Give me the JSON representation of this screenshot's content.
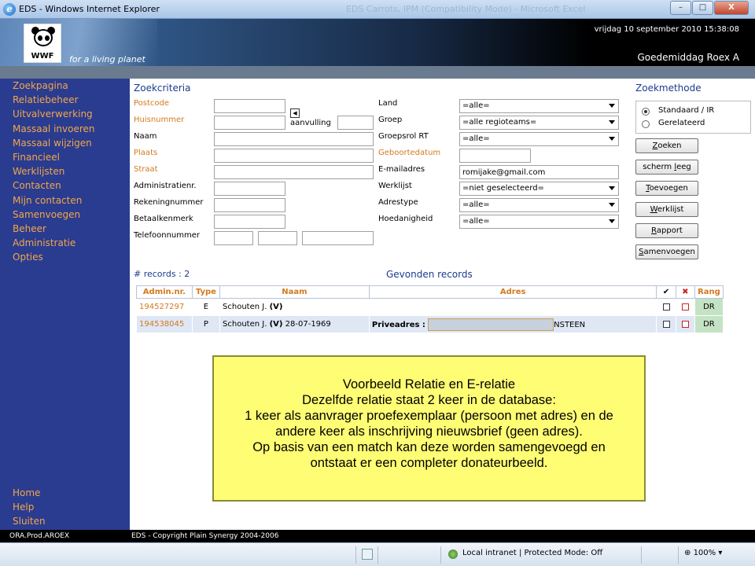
{
  "window": {
    "title": "EDS - Windows Internet Explorer",
    "faded_title": "EDS Carrots, IPM (Compatibility Mode) - Microsoft Excel",
    "controls": [
      "–",
      "□",
      "X"
    ]
  },
  "header": {
    "logo_text": "WWF",
    "tagline": "for a living planet",
    "datetime": "vrijdag 10 september 2010 15:38:08",
    "greeting": "Goedemiddag Roex A"
  },
  "sidebar": {
    "items": [
      {
        "label": "Zoekpagina"
      },
      {
        "label": "Relatiebeheer"
      },
      {
        "label": "Uitvalverwerking"
      },
      {
        "label": "Massaal invoeren"
      },
      {
        "label": "Massaal wijzigen"
      },
      {
        "label": "Financieel"
      },
      {
        "label": "Werklijsten"
      },
      {
        "label": "Contacten"
      },
      {
        "label": "Mijn contacten"
      },
      {
        "label": "Samenvoegen"
      },
      {
        "label": "Beheer"
      },
      {
        "label": "Administratie"
      },
      {
        "label": "Opties"
      }
    ],
    "bottom_items": [
      {
        "label": "Home"
      },
      {
        "label": "Help"
      },
      {
        "label": "Sluiten"
      }
    ],
    "status": "ORA.Prod.AROEX"
  },
  "search": {
    "title": "Zoekcriteria",
    "fields_left": {
      "postcode": "Postcode",
      "huisnummer": "Huisnummer",
      "aanvulling": "aanvulling",
      "naam": "Naam",
      "plaats": "Plaats",
      "straat": "Straat",
      "administratienr": "Administratienr.",
      "rekeningnummer": "Rekeningnummer",
      "betaalkenmerk": "Betaalkenmerk",
      "telefoonnummer": "Telefoonnummer"
    },
    "fields_right": {
      "land": {
        "label": "Land",
        "value": "=alle="
      },
      "groep": {
        "label": "Groep",
        "value": "=alle regioteams="
      },
      "groepsrol": {
        "label": "Groepsrol RT",
        "value": "=alle="
      },
      "geboortedatum": {
        "label": "Geboortedatum",
        "value": ""
      },
      "email": {
        "label": "E-mailadres",
        "value": "romijake@gmail.com"
      },
      "werklijst": {
        "label": "Werklijst",
        "value": "=niet geselecteerd="
      },
      "adrestype": {
        "label": "Adrestype",
        "value": "=alle="
      },
      "hoedanigheid": {
        "label": "Hoedanigheid",
        "value": "=alle="
      }
    }
  },
  "method": {
    "title": "Zoekmethode",
    "options": [
      {
        "label": "Standaard / IR",
        "selected": true
      },
      {
        "label": "Gerelateerd",
        "selected": false
      }
    ],
    "buttons": {
      "zoeken_u": "Z",
      "zoeken_rest": "oeken",
      "scherm_pre": "scherm ",
      "scherm_u": "l",
      "scherm_rest": "eeg",
      "toevoegen_u": "T",
      "toevoegen_rest": "oevoegen",
      "werklijst_u": "W",
      "werklijst_rest": "erklijst",
      "rapport_u": "R",
      "rapport_rest": "apport",
      "samenvoegen_u": "S",
      "samenvoegen_rest": "amenvoegen"
    }
  },
  "results": {
    "count_label": "# records : 2",
    "title": "Gevonden records",
    "columns": [
      "Admin.nr.",
      "Type",
      "Naam",
      "Adres",
      "✔",
      "✖",
      "Rang"
    ],
    "rows": [
      {
        "admin": "194527297",
        "type": "E",
        "naam": "Schouten J.",
        "naam_v": "(V)",
        "naam_extra": "",
        "adres_label": "",
        "adres_tail": "",
        "rang": "DR"
      },
      {
        "admin": "194538045",
        "type": "P",
        "naam": "Schouten J.",
        "naam_v": "(V)",
        "naam_extra": "28-07-1969",
        "adres_label": "Priveadres :",
        "adres_tail": "NSTEEN",
        "rang": "DR"
      }
    ]
  },
  "footer": {
    "copyright": "EDS - Copyright Plain Synergy 2004-2006"
  },
  "note": {
    "lines": [
      "Voorbeeld Relatie en E-relatie",
      "Dezelfde relatie staat 2 keer in de database:",
      "1 keer als aanvrager proefexemplaar (persoon met adres) en de",
      "andere keer als inschrijving nieuwsbrief (geen adres).",
      "Op basis van een match kan deze worden samengevoegd en",
      "ontstaat er een completer donateurbeeld."
    ]
  },
  "ie_status": {
    "zone": "Local intranet | Protected Mode: Off",
    "zoom": "100%"
  },
  "colors": {
    "sidebar_bg": "#2a3c8f",
    "nav_text": "#f2a64b",
    "accent_orange": "#d27a1f",
    "note_bg": "#fffd74"
  }
}
